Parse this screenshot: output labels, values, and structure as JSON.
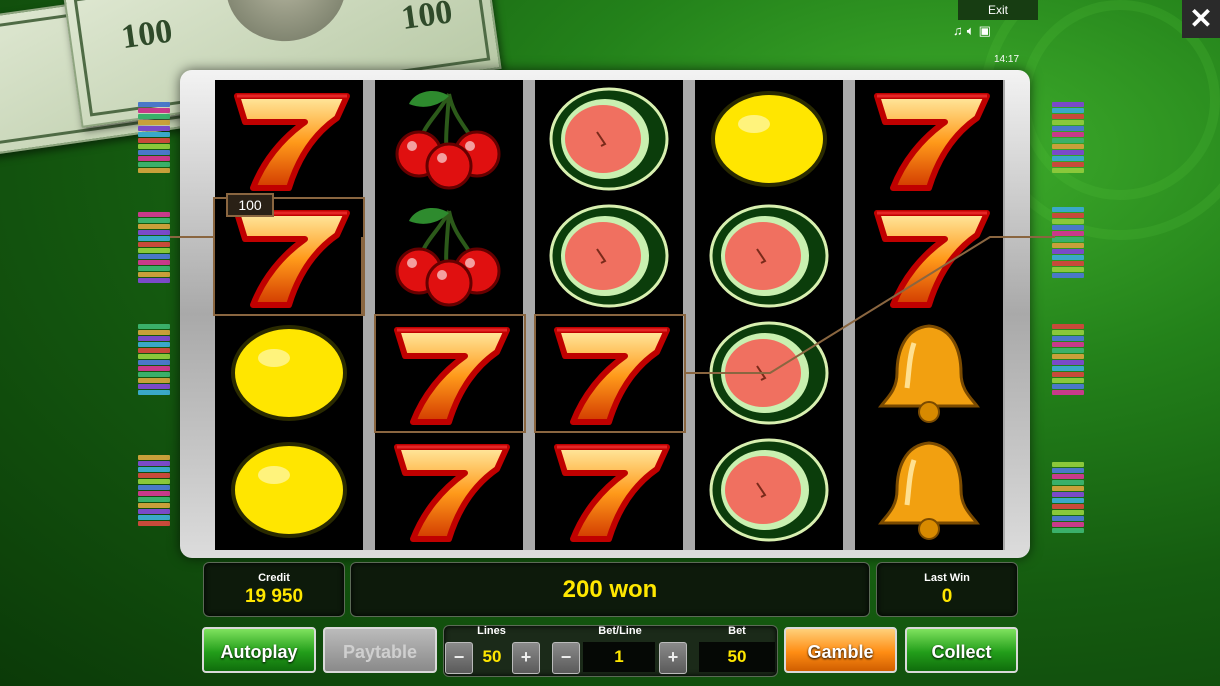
{
  "topbar": {
    "exit_label": "Exit",
    "time": "14:17",
    "icons": [
      "music-icon",
      "sound-icon",
      "fullscreen-icon"
    ]
  },
  "reels": [
    [
      "seven",
      "seven",
      "lemon",
      "lemon"
    ],
    [
      "cherry",
      "cherry",
      "seven",
      "seven"
    ],
    [
      "watermelon",
      "watermelon",
      "seven",
      "seven"
    ],
    [
      "lemon",
      "watermelon",
      "watermelon",
      "watermelon"
    ],
    [
      "seven",
      "seven",
      "bell",
      "bell"
    ]
  ],
  "win_line": {
    "label": "100"
  },
  "status": {
    "credit_label": "Credit",
    "credit_value": "19 950",
    "message": "200 won",
    "lastwin_label": "Last Win",
    "lastwin_value": "0"
  },
  "controls": {
    "autoplay": "Autoplay",
    "paytable": "Paytable",
    "lines_label": "Lines",
    "lines_value": "50",
    "betline_label": "Bet/Line",
    "betline_value": "1",
    "bet_label": "Bet",
    "bet_value": "50",
    "gamble": "Gamble",
    "collect": "Collect",
    "minus": "−",
    "plus": "+"
  },
  "colors": {
    "accent_yellow": "#ffe700",
    "button_green": "#239e1a",
    "button_orange": "#ff8d14",
    "win_frame": "#8a6640"
  }
}
